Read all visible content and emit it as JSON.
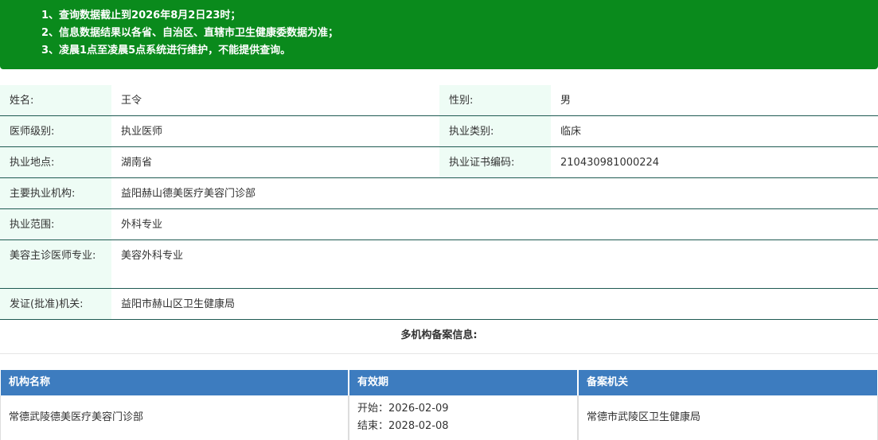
{
  "notice": {
    "lines": [
      "1、查询数据截止到2026年8月2日23时；",
      "2、信息数据结果以各省、自治区、直辖市卫生健康委数据为准；",
      "3、凌晨1点至凌晨5点系统进行维护，不能提供查询。"
    ]
  },
  "info": {
    "name_label": "姓名:",
    "name_value": "王令",
    "gender_label": "性别:",
    "gender_value": "男",
    "level_label": "医师级别:",
    "level_value": "执业医师",
    "category_label": "执业类别:",
    "category_value": "临床",
    "location_label": "执业地点:",
    "location_value": "湖南省",
    "cert_label": "执业证书编码:",
    "cert_value": "210430981000224",
    "institution_label": "主要执业机构:",
    "institution_value": "益阳赫山德美医疗美容门诊部",
    "scope_label": "执业范围:",
    "scope_value": "外科专业",
    "cosmetic_label": "美容主诊医师专业:",
    "cosmetic_value": "美容外科专业",
    "authority_label": "发证(批准)机关:",
    "authority_value": "益阳市赫山区卫生健康局"
  },
  "multi": {
    "title": "多机构备案信息:",
    "headers": [
      "机构名称",
      "有效期",
      "备案机关"
    ],
    "rows": [
      {
        "org": "常德武陵德美医疗美容门诊部",
        "start": "开始：2026-02-09",
        "end": "结束：2028-02-08",
        "authority": "常德市武陵区卫生健康局"
      }
    ]
  },
  "colors": {
    "notice_bg": "#0a8a1c",
    "label_bg": "#eefcf5",
    "row_border": "#1e5a52",
    "table_header_bg": "#3d7cbf"
  }
}
